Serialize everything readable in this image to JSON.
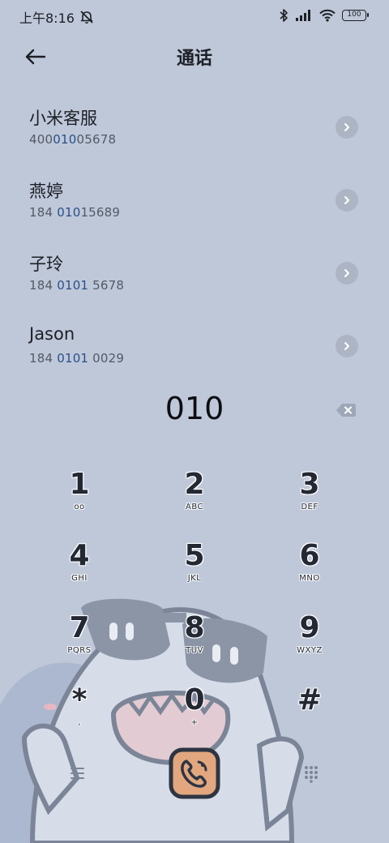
{
  "status": {
    "time": "上午8:16",
    "battery": "100",
    "icons": [
      "mute-bell-icon",
      "bluetooth-icon",
      "signal-icon",
      "wifi-icon",
      "battery-icon"
    ]
  },
  "header": {
    "title": "通话",
    "back_icon": "back-arrow-icon"
  },
  "contacts": [
    {
      "name": "小米客服",
      "number_pre": "400",
      "number_hl": "010",
      "number_post": "05678"
    },
    {
      "name": "燕婷",
      "number_pre": "184 ",
      "number_hl": "010",
      "number_post": "15689"
    },
    {
      "name": "子玲",
      "number_pre": "184 ",
      "number_hl": "0101",
      "number_post": " 5678"
    },
    {
      "name": "Jason",
      "number_pre": "184 ",
      "number_hl": "0101",
      "number_post": " 0029"
    }
  ],
  "dialed_number": "010",
  "keypad": [
    {
      "digit": "1",
      "letters": "oo"
    },
    {
      "digit": "2",
      "letters": "ABC"
    },
    {
      "digit": "3",
      "letters": "DEF"
    },
    {
      "digit": "4",
      "letters": "GHI"
    },
    {
      "digit": "5",
      "letters": "JKL"
    },
    {
      "digit": "6",
      "letters": "MNO"
    },
    {
      "digit": "7",
      "letters": "PQRS"
    },
    {
      "digit": "8",
      "letters": "TUV"
    },
    {
      "digit": "9",
      "letters": "WXYZ"
    },
    {
      "digit": "*",
      "letters": ","
    },
    {
      "digit": "0",
      "letters": "+"
    },
    {
      "digit": "#",
      "letters": ""
    }
  ],
  "bottom_bar": {
    "menu_icon": "menu-icon",
    "call_icon": "phone-call-icon",
    "dialpad_icon": "dialpad-icon"
  },
  "colors": {
    "background": "#bfc8d9",
    "highlight": "#2a4f8a",
    "call_button_fill": "#e2a77e",
    "call_button_border": "#2e3442"
  }
}
